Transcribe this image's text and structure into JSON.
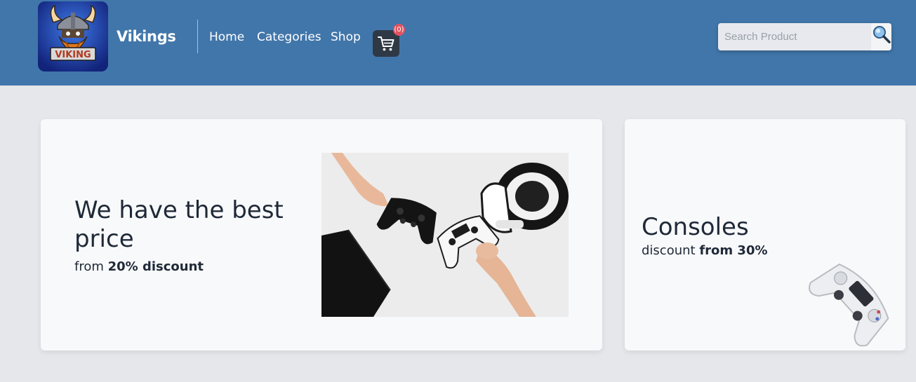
{
  "header": {
    "brand": "Vikings",
    "logo_text": "VIKING",
    "nav": [
      {
        "label": "Home"
      },
      {
        "label": "Categories"
      },
      {
        "label": "Shop"
      }
    ],
    "cart": {
      "count_label": "(0)",
      "icon": "cart-icon"
    },
    "search": {
      "placeholder": "Search Product",
      "value": "",
      "icon": "search-icon"
    }
  },
  "main_banner": {
    "title": "We have the best price",
    "subtitle_prefix": "from",
    "subtitle_emphasis": "20% discount",
    "image": "controllers-and-vr-headset-photo"
  },
  "side_banner": {
    "title": "Consoles",
    "subtitle_prefix": "discount",
    "subtitle_emphasis": "from 30%",
    "image": "white-gamepad-photo"
  },
  "colors": {
    "navbar": "#4176aa",
    "page_background": "#e5e7eb",
    "card_background": "#f8f9fb",
    "badge": "#e05260",
    "text_dark": "#1f2937"
  }
}
